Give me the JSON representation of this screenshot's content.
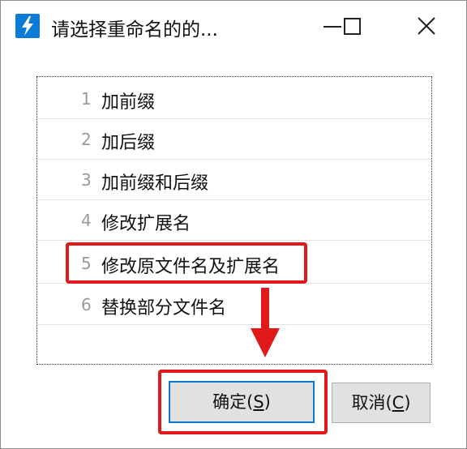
{
  "window": {
    "title": "请选择重命名的的...",
    "minimize_icon": "minimize-icon",
    "maximize_icon": "maximize-icon",
    "close_icon": "close-icon"
  },
  "options": [
    {
      "num": "1",
      "label": "加前缀"
    },
    {
      "num": "2",
      "label": "加后缀"
    },
    {
      "num": "3",
      "label": "加前缀和后缀"
    },
    {
      "num": "4",
      "label": "修改扩展名"
    },
    {
      "num": "5",
      "label": "修改原文件名及扩展名"
    },
    {
      "num": "6",
      "label": "替换部分文件名"
    }
  ],
  "buttons": {
    "ok_prefix": "确定(",
    "ok_key": "S",
    "ok_suffix": ")",
    "cancel_prefix": "取消(",
    "cancel_key": "C",
    "cancel_suffix": ")"
  },
  "colors": {
    "highlight": "#e0191b",
    "accent": "#0a7bd6"
  }
}
